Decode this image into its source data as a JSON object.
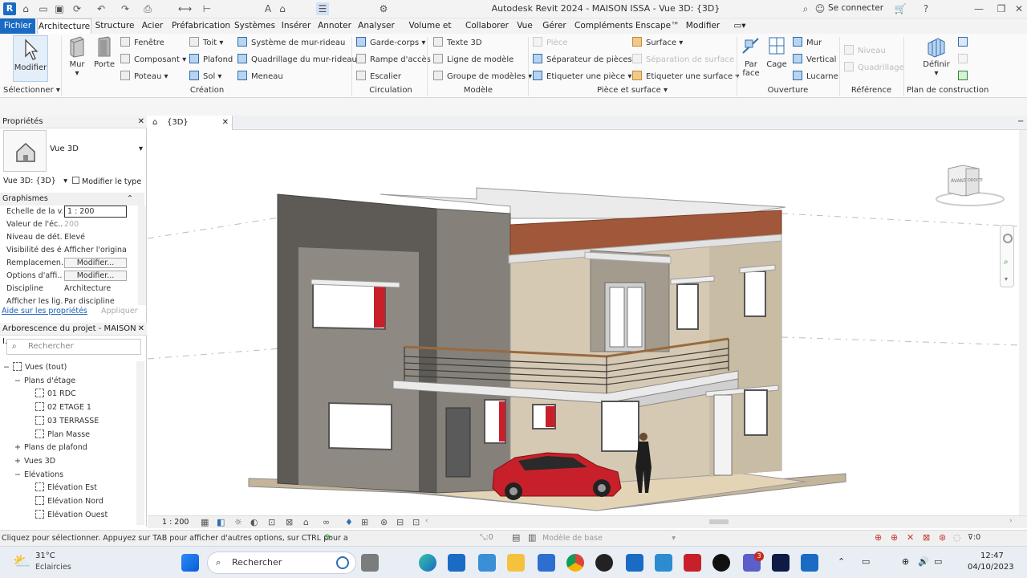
{
  "titlebar": {
    "title": "Autodesk Revit 2024 - MAISON ISSA - Vue 3D: {3D}",
    "sign_in": "Se connecter",
    "app_letter": "R"
  },
  "menus": [
    "Fichier",
    "Architecture",
    "Structure",
    "Acier",
    "Préfabrication",
    "Systèmes",
    "Insérer",
    "Annoter",
    "Analyser",
    "Volume et site",
    "Collaborer",
    "Vue",
    "Gérer",
    "Compléments",
    "Enscape™",
    "Modifier"
  ],
  "ribbon": {
    "modifier": "Modifier",
    "mur": "Mur",
    "porte": "Porte",
    "fenetre": "Fenêtre",
    "composant": "Composant",
    "poteau": "Poteau",
    "toit": "Toit",
    "plafond": "Plafond",
    "sol": "Sol",
    "systeme_mur_rideau": "Système de mur-rideau",
    "quadrillage_mur_rideau": "Quadrillage du mur-rideau",
    "meneau": "Meneau",
    "garde_corps": "Garde-corps",
    "rampe": "Rampe d'accès",
    "escalier": "Escalier",
    "texte_3d": "Texte 3D",
    "ligne_modele": "Ligne de modèle",
    "groupe_modeles": "Groupe de modèles",
    "piece": "Pièce",
    "separateur_pieces": "Séparateur  de pièces",
    "etiqueter_piece": "Etiqueter  une pièce",
    "surface": "Surface",
    "separation_surface": "Séparation de surface",
    "etiqueter_surface": "Etiqueter  une surface",
    "par_face_1": "Par",
    "par_face_2": "face",
    "cage": "Cage",
    "mur_ouv": "Mur",
    "vertical": "Vertical",
    "lucarne": "Lucarne",
    "niveau": "Niveau",
    "quadrillage": "Quadrillage",
    "definir": "Définir",
    "groups": {
      "selectionner": "Sélectionner",
      "creation": "Création",
      "circulation": "Circulation",
      "modele": "Modèle",
      "piece_surface": "Pièce et surface",
      "ouverture": "Ouverture",
      "reference": "Référence",
      "plan_construction": "Plan de construction"
    }
  },
  "properties": {
    "header": "Propriétés",
    "type_name": "Vue 3D",
    "selector": "Vue 3D: {3D}",
    "edit_type": "Modifier le type",
    "section": "Graphismes",
    "rows": [
      {
        "k": "Echelle de la v...",
        "v": "1 : 200",
        "kind": "input"
      },
      {
        "k": "Valeur de l'éc...",
        "v": "200",
        "kind": "muted"
      },
      {
        "k": "Niveau de dét...",
        "v": "Elevé",
        "kind": "text"
      },
      {
        "k": "Visibilité des é...",
        "v": "Afficher l'original",
        "kind": "text"
      },
      {
        "k": "Remplacemen...",
        "v": "Modifier...",
        "kind": "btn"
      },
      {
        "k": "Options d'affi...",
        "v": "Modifier...",
        "kind": "btn"
      },
      {
        "k": "Discipline",
        "v": "Architecture",
        "kind": "text"
      },
      {
        "k": "Afficher les lig...",
        "v": "Par discipline",
        "kind": "text"
      }
    ],
    "help": "Aide sur les propriétés",
    "apply": "Appliquer"
  },
  "browser": {
    "header": "Arborescence du projet - MAISON I...",
    "search_placeholder": "Rechercher",
    "nodes": [
      {
        "label": "Vues (tout)",
        "level": 0,
        "sign": "−",
        "box": true
      },
      {
        "label": "Plans d'étage",
        "level": 1,
        "sign": "−",
        "box": false
      },
      {
        "label": "01 RDC",
        "level": 2,
        "sign": "",
        "box": true
      },
      {
        "label": "02 ETAGE 1",
        "level": 2,
        "sign": "",
        "box": true
      },
      {
        "label": "03 TERRASSE",
        "level": 2,
        "sign": "",
        "box": true
      },
      {
        "label": "Plan Masse",
        "level": 2,
        "sign": "",
        "box": true
      },
      {
        "label": "Plans de plafond",
        "level": 1,
        "sign": "+",
        "box": false
      },
      {
        "label": "Vues 3D",
        "level": 1,
        "sign": "+",
        "box": false
      },
      {
        "label": "Elévations",
        "level": 1,
        "sign": "−",
        "box": false
      },
      {
        "label": "Elévation Est",
        "level": 2,
        "sign": "",
        "box": true
      },
      {
        "label": "Elévation Nord",
        "level": 2,
        "sign": "",
        "box": true
      },
      {
        "label": "Elévation Ouest",
        "level": 2,
        "sign": "",
        "box": true
      }
    ]
  },
  "view": {
    "tab_label": "{3D}",
    "scale": "1 : 200",
    "viewcube_front": "AVANT",
    "viewcube_right": "DROITE"
  },
  "status": {
    "hint": "Cliquez pour sélectionner. Appuyez sur TAB pour afficher d'autres options, sur CTRL pour a",
    "count": ":0",
    "model": "Modèle de base",
    "filter_count": ":0"
  },
  "taskbar": {
    "weather_temp": "31°C",
    "weather_text": "Eclaircies",
    "search_placeholder": "Rechercher",
    "time": "12:47",
    "date": "04/10/2023",
    "notif_badge": "3"
  },
  "colors": {
    "accent": "#1a6bc3",
    "wall_stone": "#8e8a83",
    "wall_dark": "#5e5a55",
    "beige": "#d6c9b3",
    "brick": "#a0573a",
    "car": "#c8202a"
  }
}
